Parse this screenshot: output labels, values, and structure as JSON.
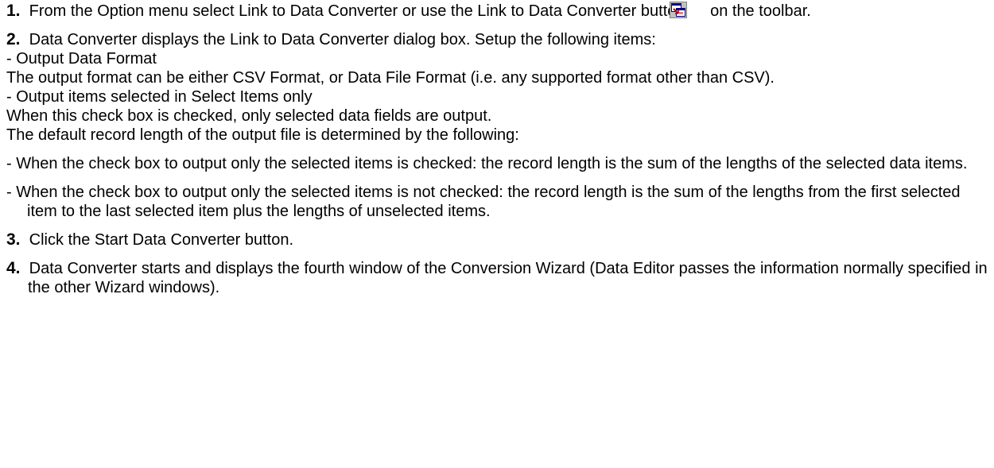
{
  "steps": {
    "s1": {
      "num": "1.",
      "text_before": "From the Option menu select Link to Data Converter or use the Link to Data Converter button",
      "icon": "data-converter-link-icon",
      "text_after": "on the toolbar."
    },
    "s2": {
      "num": "2.",
      "text": "Data Converter displays the Link to Data Converter dialog box. Setup the following items:",
      "item1_title": "- Output Data Format",
      "item1_desc": "The output format can be either CSV Format, or Data File Format (i.e. any supported format other than CSV).",
      "item2_title": "- Output items selected in Select Items only",
      "item2_desc1": "When this check box is checked, only selected data fields are output.",
      "item2_desc2": "The default record length of the output file is determined by the following:",
      "bullet1": "- When the check box to output only the selected items is checked:   the record length is the sum of the lengths of the selected data items.",
      "bullet2": "- When the check box to output only the selected items is not checked:   the record length is the sum of the lengths from the first selected item to the last selected item plus the lengths of unselected items."
    },
    "s3": {
      "num": "3.",
      "text": "Click the Start Data Converter button."
    },
    "s4": {
      "num": "4.",
      "text": "Data Converter starts and displays the fourth window of the Conversion Wizard (Data Editor passes the information normally specified in the other Wizard windows)."
    }
  }
}
